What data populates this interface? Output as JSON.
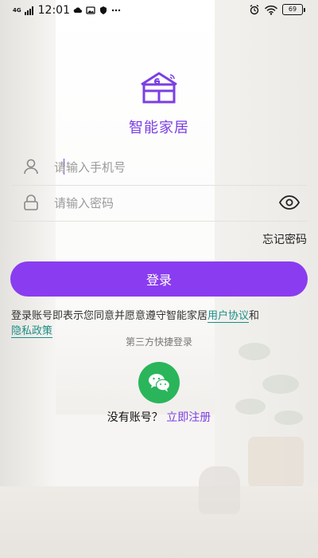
{
  "status_bar": {
    "network": "4G",
    "time": "12:01",
    "battery": "69"
  },
  "app": {
    "title": "智能家居"
  },
  "login": {
    "phone_placeholder": "请输入手机号",
    "password_placeholder": "请输入密码",
    "forgot_password": "忘记密码",
    "login_button": "登录"
  },
  "agreement": {
    "text": "登录账号即表示您同意并愿意遵守智能家居",
    "user_agreement": "用户协议",
    "and": "和",
    "privacy_policy": "隐私政策"
  },
  "third_party": {
    "label": "第三方快捷登录",
    "wechat_icon": "wechat-icon"
  },
  "register": {
    "prompt": "没有账号？",
    "link": "立即注册"
  },
  "colors": {
    "brand_purple": "#8a3cf0",
    "link_teal": "#1d8e86",
    "wechat_green": "#2ab55b"
  }
}
